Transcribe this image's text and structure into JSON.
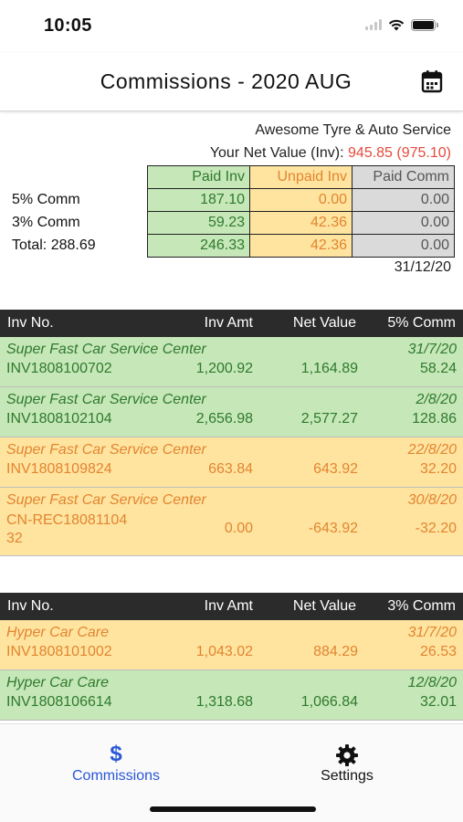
{
  "status": {
    "time": "10:05"
  },
  "nav": {
    "title": "Commissions - 2020 AUG"
  },
  "summary": {
    "company": "Awesome Tyre & Auto Service",
    "net_label": "Your Net Value (Inv):",
    "net_value": "945.85 (975.10)",
    "headers": {
      "paid": "Paid Inv",
      "unpaid": "Unpaid Inv",
      "comm": "Paid Comm"
    },
    "rows": [
      {
        "label": "5% Comm",
        "paid": "187.10",
        "unpaid": "0.00",
        "comm": "0.00"
      },
      {
        "label": "3% Comm",
        "paid": "59.23",
        "unpaid": "42.36",
        "comm": "0.00"
      },
      {
        "label": "Total: 288.69",
        "paid": "246.33",
        "unpaid": "42.36",
        "comm": "0.00"
      }
    ],
    "date": "31/12/20"
  },
  "sections": [
    {
      "headers": {
        "inv": "Inv No.",
        "amt": "Inv Amt",
        "net": "Net Value",
        "comm": "5% Comm"
      },
      "rows": [
        {
          "customer": "Super Fast Car Service Center",
          "date": "31/7/20",
          "inv": "INV1808100702",
          "amt": "1,200.92",
          "net": "1,164.89",
          "comm": "58.24",
          "status": "paid"
        },
        {
          "customer": "Super Fast Car Service Center",
          "date": "2/8/20",
          "inv": "INV1808102104",
          "amt": "2,656.98",
          "net": "2,577.27",
          "comm": "128.86",
          "status": "paid"
        },
        {
          "customer": "Super Fast Car Service Center",
          "date": "22/8/20",
          "inv": "INV1808109824",
          "amt": "663.84",
          "net": "643.92",
          "comm": "32.20",
          "status": "unpaid"
        },
        {
          "customer": "Super Fast Car Service Center",
          "date": "30/8/20",
          "inv": "CN-REC1808110432",
          "amt": "0.00",
          "net": "-643.92",
          "comm": "-32.20",
          "status": "unpaid"
        }
      ]
    },
    {
      "headers": {
        "inv": "Inv No.",
        "amt": "Inv Amt",
        "net": "Net Value",
        "comm": "3% Comm"
      },
      "rows": [
        {
          "customer": "Hyper Car Care",
          "date": "31/7/20",
          "inv": "INV1808101002",
          "amt": "1,043.02",
          "net": "884.29",
          "comm": "26.53",
          "status": "unpaid"
        },
        {
          "customer": "Hyper Car Care",
          "date": "12/8/20",
          "inv": "INV1808106614",
          "amt": "1,318.68",
          "net": "1,066.84",
          "comm": "32.01",
          "status": "paid"
        }
      ]
    }
  ],
  "tabs": [
    {
      "label": "Commissions",
      "icon": "dollar-icon",
      "active": true
    },
    {
      "label": "Settings",
      "icon": "gear-icon",
      "active": false
    }
  ],
  "colors": {
    "paid_bg": "#c6e7b8",
    "paid_text": "#2f7a2e",
    "unpaid_bg": "#ffe4a0",
    "unpaid_text": "#e28530",
    "comm_bg": "#dadada",
    "accent": "#2a57d8",
    "net_value_red": "#e74a3b"
  }
}
